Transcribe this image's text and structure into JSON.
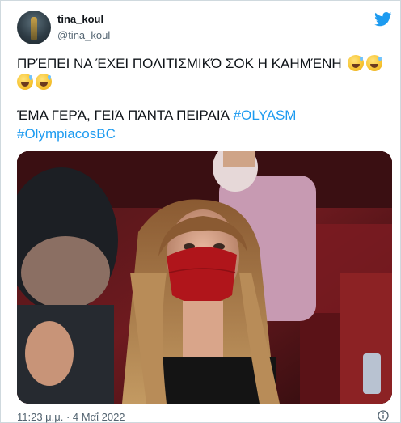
{
  "user": {
    "name": "tina_koul",
    "handle": "@tina_koul"
  },
  "tweet": {
    "line1": "ΠΡΈΠΕΙ ΝΑ ΈΧΕΙ ΠΟΛΙΤΙΣΜΙΚΌ ΣΟΚ Η ΚΑΗΜΈΝΗ",
    "line3_text": "ΈΜΑ ΓΕΡΆ, ΓΕΙΆ ΠΆΝΤΑ ΠΕΙΡΑΙΆ ",
    "hashtag1": "#OLYASM",
    "hashtag2": "#OlympiacosBC",
    "emoji_name": "grinning-face-with-sweat"
  },
  "timestamp": "11:23 μ.μ. · 4 Μαΐ 2022",
  "icons": {
    "brand": "twitter-bird-icon",
    "info": "info-icon"
  },
  "colors": {
    "link": "#1d9bf0",
    "secondary_text": "#536471",
    "border": "#cfd9de"
  }
}
